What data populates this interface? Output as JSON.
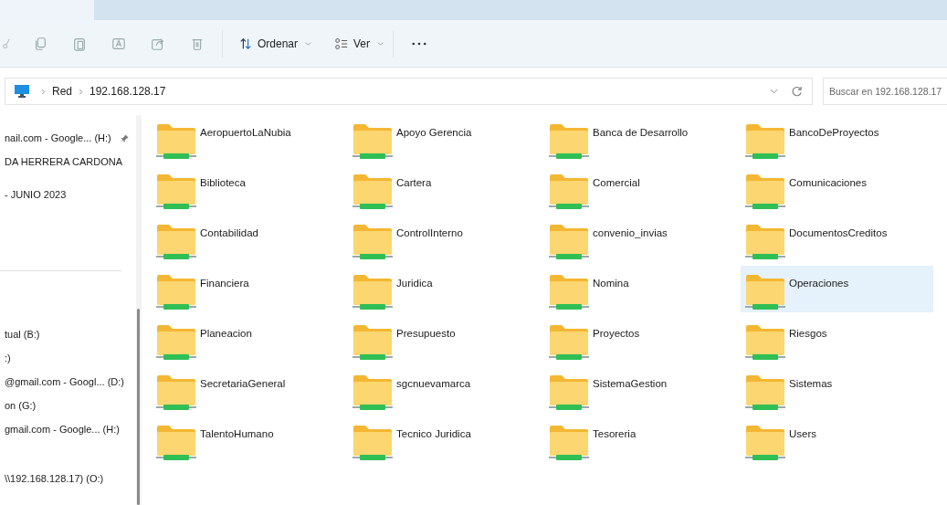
{
  "toolbar": {
    "sort_label": "Ordenar",
    "view_label": "Ver"
  },
  "address": {
    "path": [
      "Red",
      "192.168.128.17"
    ],
    "search_placeholder": "Buscar en 192.168.128.17"
  },
  "sidebar": {
    "pinned": [
      {
        "label": "nail.com - Google... (H:)",
        "pinned": true
      },
      {
        "label": "DA HERRERA CARDONA",
        "pinned": false
      },
      {
        "label": "- JUNIO 2023",
        "pinned": false
      }
    ],
    "drives": [
      {
        "label": "tual (B:)"
      },
      {
        "label": ":)"
      },
      {
        "label": "@gmail.com - Googl... (D:)"
      },
      {
        "label": "on (G:)"
      },
      {
        "label": "gmail.com - Google... (H:)"
      },
      {
        "label": "\\\\192.168.128.17) (O:)"
      }
    ]
  },
  "folders": [
    {
      "name": "AeropuertoLaNubia",
      "selected": false
    },
    {
      "name": "Apoyo Gerencia",
      "selected": false
    },
    {
      "name": "Banca de Desarrollo",
      "selected": false
    },
    {
      "name": "BancoDeProyectos",
      "selected": false
    },
    {
      "name": "Biblioteca",
      "selected": false
    },
    {
      "name": "Cartera",
      "selected": false
    },
    {
      "name": "Comercial",
      "selected": false
    },
    {
      "name": "Comunicaciones",
      "selected": false
    },
    {
      "name": "Contabilidad",
      "selected": false
    },
    {
      "name": "ControlInterno",
      "selected": false
    },
    {
      "name": "convenio_invias",
      "selected": false
    },
    {
      "name": "DocumentosCreditos",
      "selected": false
    },
    {
      "name": "Financiera",
      "selected": false
    },
    {
      "name": "Juridica",
      "selected": false
    },
    {
      "name": "Nomina",
      "selected": false
    },
    {
      "name": "Operaciones",
      "selected": true
    },
    {
      "name": "Planeacion",
      "selected": false
    },
    {
      "name": "Presupuesto",
      "selected": false
    },
    {
      "name": "Proyectos",
      "selected": false
    },
    {
      "name": "Riesgos",
      "selected": false
    },
    {
      "name": "SecretariaGeneral",
      "selected": false
    },
    {
      "name": "sgcnuevamarca",
      "selected": false
    },
    {
      "name": "SistemaGestion",
      "selected": false
    },
    {
      "name": "Sistemas",
      "selected": false
    },
    {
      "name": "TalentoHumano",
      "selected": false
    },
    {
      "name": "Tecnico Juridica",
      "selected": false
    },
    {
      "name": "Tesoreria",
      "selected": false
    },
    {
      "name": "Users",
      "selected": false
    }
  ]
}
